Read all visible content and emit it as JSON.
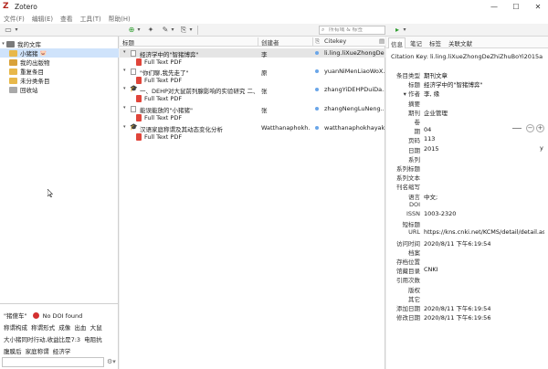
{
  "window": {
    "app_title": "Zotero",
    "logo_letter": "Z",
    "min": "—",
    "max": "☐",
    "close": "✕"
  },
  "menu": [
    "文件(F)",
    "编辑(E)",
    "查看",
    "工具(T)",
    "帮助(H)"
  ],
  "toolbar": {
    "new_collection": "▭",
    "new_item": "⊕",
    "dropdown": "▾",
    "magic_wand": "✦",
    "new_note": "✎",
    "attach": "⎘",
    "locate": "▸",
    "search_placeholder": "所有域 & 标签"
  },
  "collections": [
    {
      "label": "我的文库",
      "twisty": "▾",
      "icon": "library",
      "indent": 0,
      "selected": false
    },
    {
      "label": "小猪猪",
      "twisty": "",
      "icon": "folder-yellow",
      "indent": 1,
      "selected": true,
      "badge": "🐷"
    },
    {
      "label": "我的出版物",
      "twisty": "",
      "icon": "publications",
      "indent": 1,
      "selected": false
    },
    {
      "label": "重复条目",
      "twisty": "",
      "icon": "duplicate",
      "indent": 1,
      "selected": false
    },
    {
      "label": "未分类条目",
      "twisty": "",
      "icon": "unfiled",
      "indent": 1,
      "selected": false
    },
    {
      "label": "回收站",
      "twisty": "",
      "icon": "trash",
      "indent": 1,
      "selected": false
    }
  ],
  "tags": {
    "rows": [
      [
        "\"猪傻车\"",
        "No DOI found"
      ],
      [
        "称谓构成",
        "称谓形式",
        "成像",
        "出血",
        "大鼠"
      ],
      [
        "大小猪同时行动,收益比是7:3",
        "电阻抗"
      ],
      [
        "腹膜后",
        "家庭称谓",
        "经济学"
      ]
    ]
  },
  "columns": {
    "title": "标题",
    "creator": "创建者",
    "citekey": "Citekey"
  },
  "items": [
    {
      "type": "doc",
      "title": "经济学中的\"智猪博弈\"",
      "creator": "李",
      "citekey": "li.ling.liXueZhongDe...",
      "twisty": "▾",
      "selected": true
    },
    {
      "type": "pdf",
      "title": "Full Text PDF",
      "creator": "",
      "citekey": ""
    },
    {
      "type": "doc",
      "title": "\"你们聊,我先走了\"",
      "creator": "原",
      "citekey": "yuanNiMenLiaoWoX...",
      "twisty": "▾"
    },
    {
      "type": "pdf",
      "title": "Full Text PDF",
      "creator": "",
      "citekey": ""
    },
    {
      "type": "cap",
      "title": "一、DEHP对大鼠前列腺影响的实验研究 二、...",
      "creator": "张",
      "citekey": "zhangYiDEHPDuiDa...",
      "twisty": "▾"
    },
    {
      "type": "pdf",
      "title": "Full Text PDF",
      "creator": "",
      "citekey": ""
    },
    {
      "type": "doc",
      "title": "能误能放的\"小猪猪\"",
      "creator": "张",
      "citekey": "zhangNengLuNeng...",
      "twisty": "▾"
    },
    {
      "type": "pdf",
      "title": "Full Text PDF",
      "creator": "",
      "citekey": ""
    },
    {
      "type": "cap",
      "title": "汉语家庭称谓及其动态变化分析",
      "creator": "Watthanaphokh...",
      "citekey": "watthanaphokhayak...",
      "twisty": "▾"
    },
    {
      "type": "pdf",
      "title": "Full Text PDF",
      "creator": "",
      "citekey": ""
    }
  ],
  "tabs": [
    "信息",
    "笔记",
    "标签",
    "关联文献"
  ],
  "info": {
    "citation_key_label": "Citation Key:",
    "citation_key": "li.ling.liXueZhongDeZhiZhuBoYi2015a",
    "fields": [
      {
        "label": "条目类型",
        "value": "期刊文章"
      },
      {
        "label": "标题",
        "value": "经济学中的\"智猪博弈\""
      },
      {
        "label": "▾ 作者",
        "value": "李, 缘"
      },
      {
        "label": "摘要",
        "value": ""
      },
      {
        "label": "期刊",
        "value": "企业管理"
      },
      {
        "label": "卷",
        "value": ""
      },
      {
        "label": "期",
        "value": "04"
      },
      {
        "label": "页码",
        "value": "113"
      },
      {
        "label": "日期",
        "value": "2015"
      },
      {
        "label": "系列",
        "value": ""
      },
      {
        "label": "系列标题",
        "value": ""
      },
      {
        "label": "系列文本",
        "value": ""
      },
      {
        "label": "刊名缩写",
        "value": ""
      },
      {
        "label": "语言",
        "value": "中文;"
      },
      {
        "label": "DOI",
        "value": ""
      },
      {
        "label": "ISSN",
        "value": "1003-2320"
      },
      {
        "label": "短标题",
        "value": ""
      },
      {
        "label": "URL",
        "value": "https://kns.cnki.net/KCMS/detail/detail.as..."
      },
      {
        "label": "访问时间",
        "value": "2020/8/11 下午6:19:54"
      },
      {
        "label": "档案",
        "value": ""
      },
      {
        "label": "存档位置",
        "value": ""
      },
      {
        "label": "馆藏目录",
        "value": "CNKI"
      },
      {
        "label": "引用次数",
        "value": ""
      },
      {
        "label": "版权",
        "value": ""
      },
      {
        "label": "其它",
        "value": ""
      },
      {
        "label": "添加日期",
        "value": "2020/8/11 下午6:19:54"
      },
      {
        "label": "修改日期",
        "value": "2020/8/11 下午6:19:56"
      }
    ],
    "date_suffix": "y",
    "minus": "−",
    "plus": "+"
  }
}
